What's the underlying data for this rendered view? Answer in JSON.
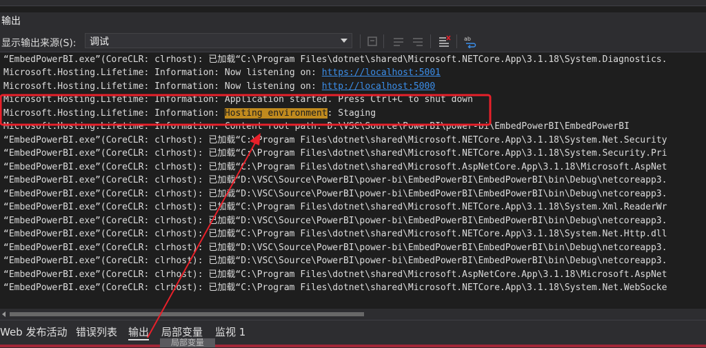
{
  "panel": {
    "title": "输出"
  },
  "toolbar": {
    "source_label": "显示输出来源(S):",
    "source_value": "调试"
  },
  "output_lines": [
    "“EmbedPowerBI.exe”(CoreCLR: clrhost): 已加载“C:\\Program Files\\dotnet\\shared\\Microsoft.NETCore.App\\3.1.18\\System.Diagnostics.",
    "Microsoft.Hosting.Lifetime: Information: Now listening on: ",
    "Microsoft.Hosting.Lifetime: Information: Now listening on: ",
    "Microsoft.Hosting.Lifetime: Information: Application started. Press Ctrl+C to shut down",
    "Microsoft.Hosting.Lifetime: Information: ",
    "Microsoft.Hosting.Lifetime: Information: Content root path: D:\\VSC\\Source\\PowerBI\\power-bi\\EmbedPowerBI\\EmbedPowerBI",
    "“EmbedPowerBI.exe”(CoreCLR: clrhost): 已加载“C:\\Program Files\\dotnet\\shared\\Microsoft.NETCore.App\\3.1.18\\System.Net.Security",
    "“EmbedPowerBI.exe”(CoreCLR: clrhost): 已加载“C:\\Program Files\\dotnet\\shared\\Microsoft.NETCore.App\\3.1.18\\System.Security.Pri",
    "“EmbedPowerBI.exe”(CoreCLR: clrhost): 已加载“C:\\Program Files\\dotnet\\shared\\Microsoft.AspNetCore.App\\3.1.18\\Microsoft.AspNet",
    "“EmbedPowerBI.exe”(CoreCLR: clrhost): 已加载“D:\\VSC\\Source\\PowerBI\\power-bi\\EmbedPowerBI\\EmbedPowerBI\\bin\\Debug\\netcoreapp3.",
    "“EmbedPowerBI.exe”(CoreCLR: clrhost): 已加载“D:\\VSC\\Source\\PowerBI\\power-bi\\EmbedPowerBI\\EmbedPowerBI\\bin\\Debug\\netcoreapp3.",
    "“EmbedPowerBI.exe”(CoreCLR: clrhost): 已加载“C:\\Program Files\\dotnet\\shared\\Microsoft.NETCore.App\\3.1.18\\System.Xml.ReaderWr",
    "“EmbedPowerBI.exe”(CoreCLR: clrhost): 已加载“D:\\VSC\\Source\\PowerBI\\power-bi\\EmbedPowerBI\\EmbedPowerBI\\bin\\Debug\\netcoreapp3.",
    "“EmbedPowerBI.exe”(CoreCLR: clrhost): 已加载“C:\\Program Files\\dotnet\\shared\\Microsoft.NETCore.App\\3.1.18\\System.Net.Http.dll",
    "“EmbedPowerBI.exe”(CoreCLR: clrhost): 已加载“D:\\VSC\\Source\\PowerBI\\power-bi\\EmbedPowerBI\\EmbedPowerBI\\bin\\Debug\\netcoreapp3.",
    "“EmbedPowerBI.exe”(CoreCLR: clrhost): 已加载“D:\\VSC\\Source\\PowerBI\\power-bi\\EmbedPowerBI\\EmbedPowerBI\\bin\\Debug\\netcoreapp3.",
    "“EmbedPowerBI.exe”(CoreCLR: clrhost): 已加载“C:\\Program Files\\dotnet\\shared\\Microsoft.AspNetCore.App\\3.1.18\\Microsoft.AspNet",
    "“EmbedPowerBI.exe”(CoreCLR: clrhost): 已加载“C:\\Program Files\\dotnet\\shared\\Microsoft.NETCore.App\\3.1.18\\System.Net.WebSocke"
  ],
  "links": {
    "https": "https://localhost:5001",
    "http": "http://localhost:5000"
  },
  "highlight": {
    "text": "Hosting environment",
    "rest": ": Staging"
  },
  "tabs": [
    "Web 发布活动",
    "错误列表",
    "输出",
    "局部变量",
    "监视 1"
  ],
  "tooltip": "局部变量",
  "colors": {
    "background": "#1e1e1e",
    "link": "#3b8eea",
    "highlight": "#c08a1e",
    "annotation": "#e8202a"
  }
}
